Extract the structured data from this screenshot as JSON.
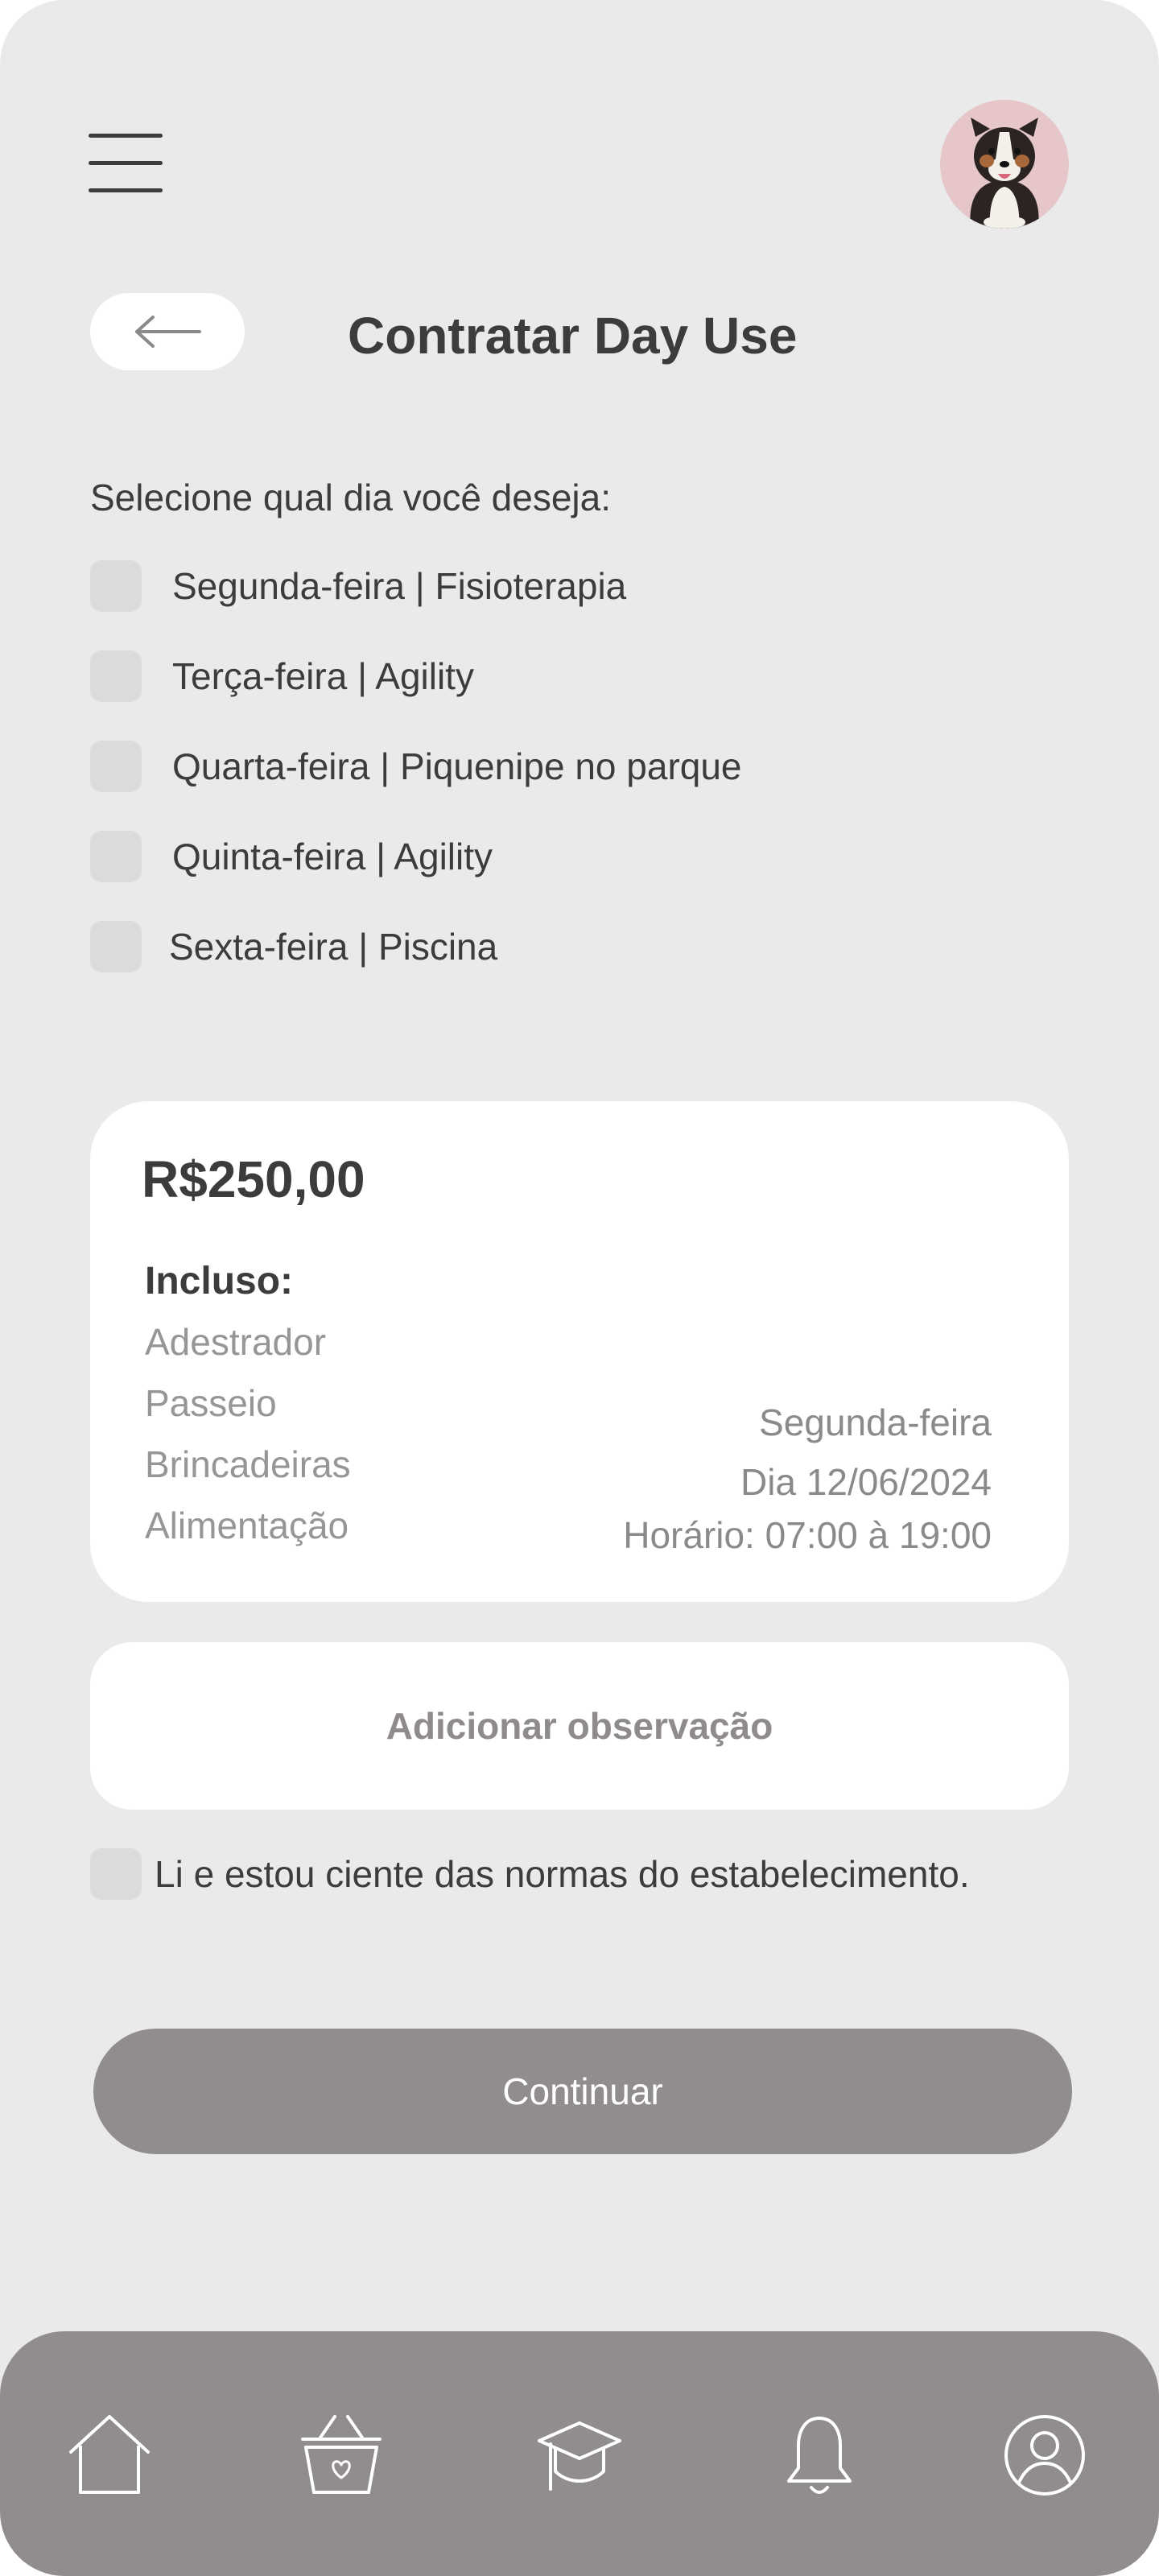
{
  "header": {
    "title": "Contratar Day Use",
    "menu_icon": "hamburger-menu-icon",
    "back_icon": "arrow-left-icon",
    "avatar": "dog-avatar"
  },
  "days": {
    "question": "Selecione qual dia você deseja:",
    "options": [
      {
        "label": "Segunda-feira | Fisioterapia",
        "checked": false
      },
      {
        "label": "Terça-feira | Agility",
        "checked": false
      },
      {
        "label": "Quarta-feira | Piquenipe no parque",
        "checked": false
      },
      {
        "label": "Quinta-feira | Agility",
        "checked": false
      },
      {
        "label": "Sexta-feira | Piscina",
        "checked": false
      }
    ]
  },
  "summary": {
    "price": "R$250,00",
    "included_title": "Incluso:",
    "included": [
      "Adestrador",
      "Passeio",
      "Brincadeiras",
      "Alimentação"
    ],
    "day": "Segunda-feira",
    "date": "Dia 12/06/2024",
    "time": "Horário: 07:00 à 19:00"
  },
  "observation_label": "Adicionar observação",
  "terms_label": "Li e estou ciente das normas do estabelecimento.",
  "continue_label": "Continuar",
  "bottom_nav": [
    "home-icon",
    "pet-shop-basket-icon",
    "graduation-cap-icon",
    "bell-icon",
    "user-icon"
  ],
  "colors": {
    "background": "#eaeaea",
    "card": "#ffffff",
    "accent": "#928d8d",
    "text": "#3c3c3c",
    "muted": "#969696",
    "avatar_bg": "#e6c6c8"
  }
}
